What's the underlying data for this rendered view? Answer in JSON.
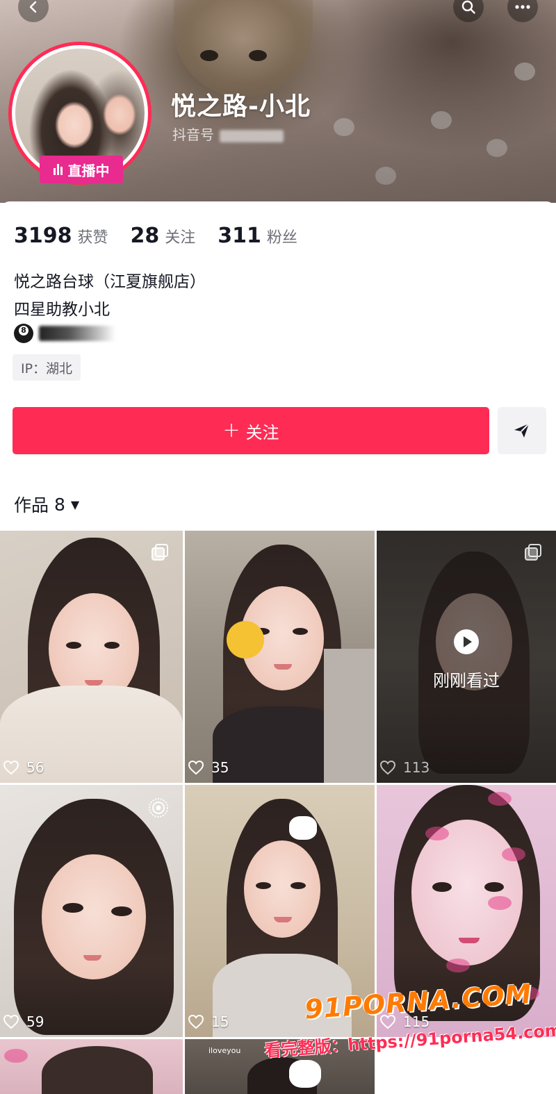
{
  "header": {
    "display_name": "悦之路-小北",
    "id_label": "抖音号",
    "live_badge": "直播中"
  },
  "stats": [
    {
      "value": "3198",
      "label": "获赞"
    },
    {
      "value": "28",
      "label": "关注"
    },
    {
      "value": "311",
      "label": "粉丝"
    }
  ],
  "bio": {
    "line1": "悦之路台球（江夏旗舰店）",
    "line2": "四星助教小北",
    "ip": "IP：湖北"
  },
  "actions": {
    "follow_label": "关注",
    "follow_plus": "+"
  },
  "works": {
    "label": "作品",
    "count": "8"
  },
  "grid": {
    "tiles": [
      {
        "likes": "56"
      },
      {
        "likes": "35"
      },
      {
        "likes": "113",
        "overlay": "刚刚看过"
      },
      {
        "likes": "59"
      },
      {
        "likes": "15"
      },
      {
        "likes": "115"
      },
      {},
      {
        "tag": "iloveyou"
      },
      {}
    ]
  },
  "watermark": {
    "logo": "91PORNA.COM",
    "url": "看完整版：https://91porna54.com"
  },
  "colors": {
    "accent": "#fe2c55",
    "live": "#e92a8f"
  }
}
